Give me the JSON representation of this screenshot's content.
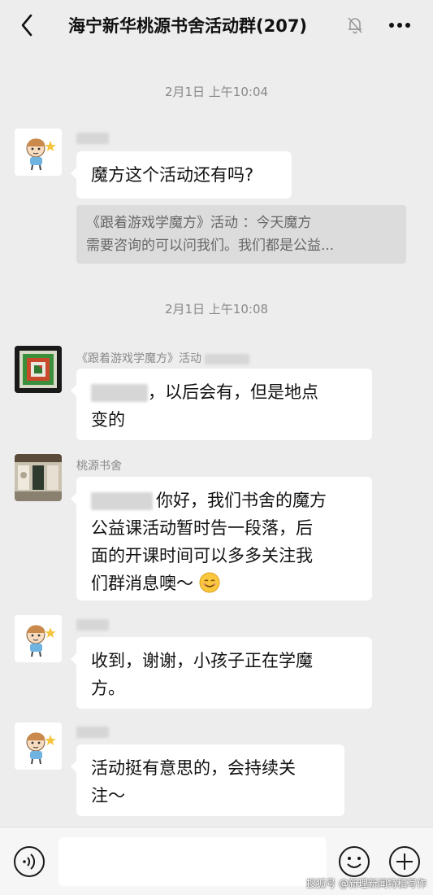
{
  "header": {
    "title": "海宁新华桃源书舍活动群(207)",
    "back_icon": "chevron-left-icon",
    "mute_icon": "bell-off-icon",
    "more_icon": "more-dots-icon"
  },
  "messages": [
    {
      "timestamp": "2月1日 上午10:04",
      "sender": "",
      "avatar": "child-cartoon-avatar",
      "text": "魔方这个活动还有吗?",
      "quote_lines": [
        "《跟着游戏学魔方》活动       ：今天魔方",
        "需要咨询的可以问我们。我们都是公益..."
      ]
    },
    {
      "timestamp": "2月1日 上午10:08",
      "sender": "《跟着游戏学魔方》活动",
      "avatar": "rubiks-cube-avatar",
      "text_lines": [
        "，以后会有，但是地点",
        "变的"
      ]
    },
    {
      "sender": "桃源书舍",
      "avatar": "bookstore-avatar",
      "text_lines": [
        "你好，我们书舍的魔方",
        "公益课活动暂时告一段落，后",
        "面的开课时间可以多多关注我",
        "们群消息噢～"
      ]
    },
    {
      "sender": "",
      "avatar": "child-cartoon-avatar",
      "text_lines": [
        "收到，谢谢，小孩子正在学魔",
        "方。"
      ]
    },
    {
      "sender": "",
      "avatar": "child-cartoon-avatar",
      "text_lines": [
        "活动挺有意思的，会持续关",
        "注～"
      ]
    }
  ],
  "input_bar": {
    "voice_icon": "voice-icon",
    "emoji_icon": "emoji-icon",
    "plus_icon": "plus-icon"
  },
  "watermark": "搜狐号 @新理新闻特稿写作"
}
